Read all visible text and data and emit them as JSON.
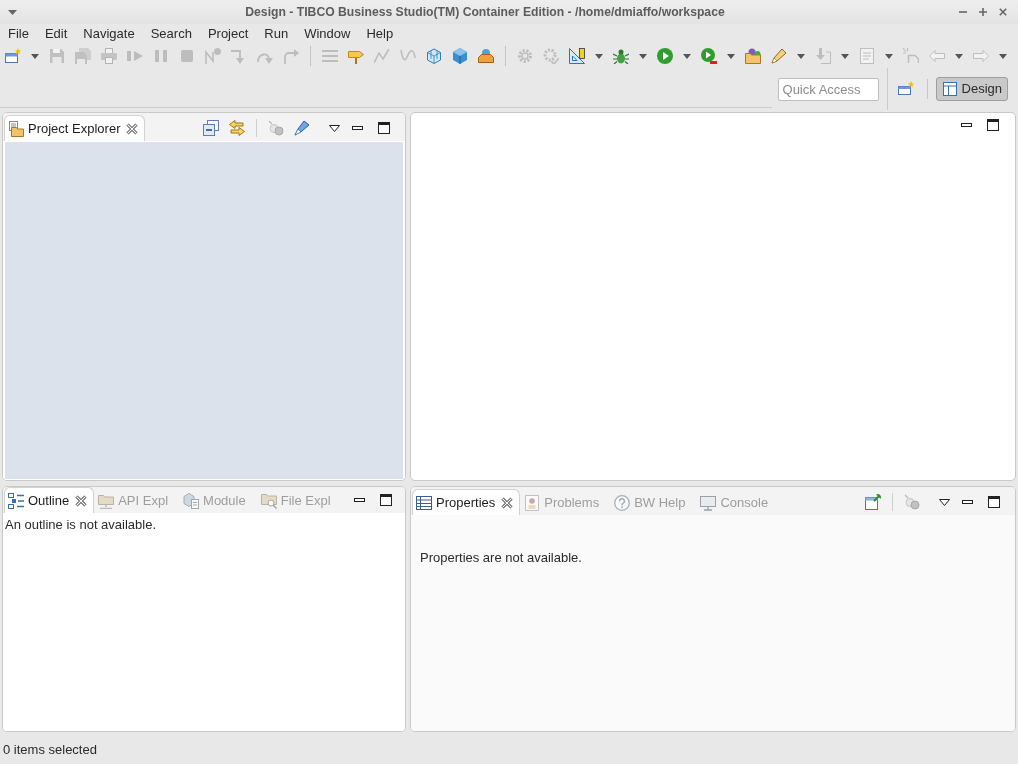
{
  "window": {
    "title": "Design - TIBCO Business Studio(TM) Container Edition - /home/dmiaffo/workspace"
  },
  "menu": [
    "File",
    "Edit",
    "Navigate",
    "Search",
    "Project",
    "Run",
    "Window",
    "Help"
  ],
  "toolbar": [
    {
      "buttons": [
        {
          "disabled": false,
          "dropdown": true
        },
        {
          "disabled": true,
          "dropdown": false
        },
        {
          "disabled": true,
          "dropdown": false
        },
        {
          "disabled": true,
          "dropdown": false
        },
        {
          "disabled": true,
          "dropdown": false
        },
        {
          "disabled": true,
          "dropdown": false
        },
        {
          "disabled": true,
          "dropdown": false
        },
        {
          "disabled": true,
          "dropdown": false
        },
        {
          "disabled": true,
          "dropdown": false
        },
        {
          "disabled": true,
          "dropdown": false
        },
        {
          "disabled": true,
          "dropdown": false
        }
      ]
    },
    {
      "buttons": [
        {
          "disabled": true,
          "dropdown": false
        },
        {
          "disabled": false,
          "dropdown": false
        },
        {
          "disabled": true,
          "dropdown": false
        },
        {
          "disabled": true,
          "dropdown": false
        },
        {
          "disabled": false,
          "dropdown": false
        },
        {
          "disabled": false,
          "dropdown": false
        },
        {
          "disabled": false,
          "dropdown": false
        }
      ]
    },
    {
      "buttons": [
        {
          "disabled": true,
          "dropdown": false
        },
        {
          "disabled": true,
          "dropdown": false
        },
        {
          "disabled": false,
          "dropdown": true
        },
        {
          "disabled": false,
          "dropdown": true
        },
        {
          "disabled": false,
          "dropdown": true
        },
        {
          "disabled": false,
          "dropdown": true
        },
        {
          "disabled": false,
          "dropdown": false
        },
        {
          "disabled": false,
          "dropdown": true
        },
        {
          "disabled": true,
          "dropdown": true
        },
        {
          "disabled": true,
          "dropdown": true
        },
        {
          "disabled": true,
          "dropdown": false
        },
        {
          "disabled": true,
          "dropdown": true
        },
        {
          "disabled": true,
          "dropdown": true
        }
      ]
    }
  ],
  "quick_access": {
    "placeholder": "Quick Access"
  },
  "perspectives": [
    {
      "label": "Design",
      "selected": true
    }
  ],
  "project_explorer": {
    "tabs": [
      {
        "label": "Project Explorer",
        "selected": true
      }
    ],
    "action_groups": [
      {
        "buttons": [
          {
            "disabled": false
          },
          {
            "disabled": false
          }
        ]
      },
      {
        "buttons": [
          {
            "disabled": true
          },
          {
            "disabled": false
          }
        ]
      }
    ]
  },
  "outline_view": {
    "tabs": [
      {
        "label": "Outline",
        "selected": true
      },
      {
        "label": "API Expl",
        "selected": false
      },
      {
        "label": "Module",
        "selected": false
      },
      {
        "label": "File Expl",
        "selected": false
      }
    ],
    "message": "An outline is not available."
  },
  "properties_view": {
    "tabs": [
      {
        "label": "Properties",
        "selected": true
      },
      {
        "label": "Problems",
        "selected": false
      },
      {
        "label": "BW Help",
        "selected": false
      },
      {
        "label": "Console",
        "selected": false
      }
    ],
    "action_groups": [
      {
        "buttons": [
          {
            "disabled": false
          }
        ]
      },
      {
        "buttons": [
          {
            "disabled": true
          }
        ]
      }
    ],
    "message": "Properties are not available."
  },
  "status_bar": {
    "text": "0 items selected"
  }
}
